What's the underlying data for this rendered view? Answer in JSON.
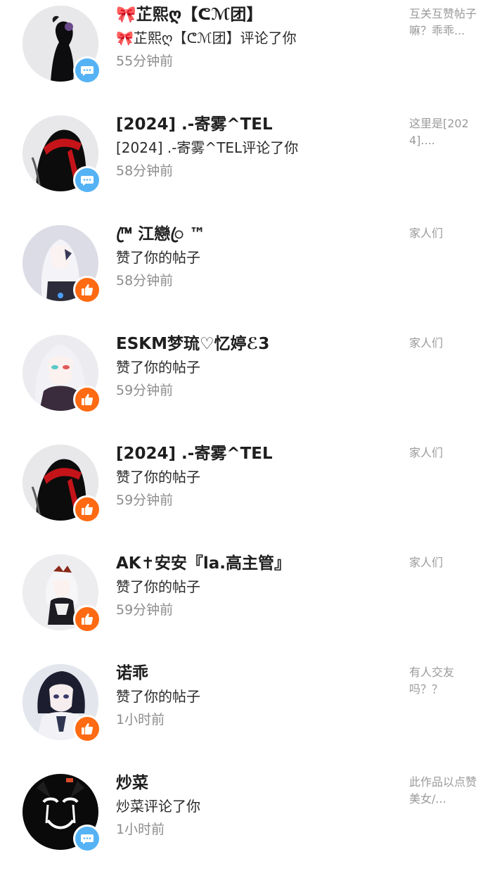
{
  "notifications": [
    {
      "name": "🎀芷熙ღ【ᕦℳ团】",
      "action": "🎀芷熙ღ【ᕦℳ团】评论了你",
      "time": "55分钟前",
      "preview": "互关互赞帖子嘛？乖乖...",
      "badge": "comment"
    },
    {
      "name": "[2024] .-寄雾^TEL",
      "action": "[2024] .-寄雾^TEL评论了你",
      "time": "58分钟前",
      "preview": "这里是[2024]....",
      "badge": "comment"
    },
    {
      "name": "™ꦿ 江戀ꦿ ™",
      "action": "赞了你的帖子",
      "time": "58分钟前",
      "preview": "家人们",
      "badge": "like"
    },
    {
      "name": "ESKM梦琉♡忆婷ℰ3",
      "action": "赞了你的帖子",
      "time": "59分钟前",
      "preview": "家人们",
      "badge": "like"
    },
    {
      "name": "[2024] .-寄雾^TEL",
      "action": "赞了你的帖子",
      "time": "59分钟前",
      "preview": "家人们",
      "badge": "like"
    },
    {
      "name": "AK✝安安『la.高主管』",
      "action": "赞了你的帖子",
      "time": "59分钟前",
      "preview": "家人们",
      "badge": "like"
    },
    {
      "name": "诺乖",
      "action": "赞了你的帖子",
      "time": "1小时前",
      "preview": "有人交友吗？？",
      "badge": "like"
    },
    {
      "name": "炒菜",
      "action": "炒菜评论了你",
      "time": "1小时前",
      "preview": "此作品以点赞美女/...",
      "badge": "comment"
    }
  ],
  "colors": {
    "comment_badge": "#55b3f5",
    "like_badge": "#ff6a12",
    "time_text": "#8c8c8c",
    "preview_text": "#9a9a9a"
  },
  "icons": {
    "comment": "chat-bubble-icon",
    "like": "thumbs-up-icon"
  }
}
